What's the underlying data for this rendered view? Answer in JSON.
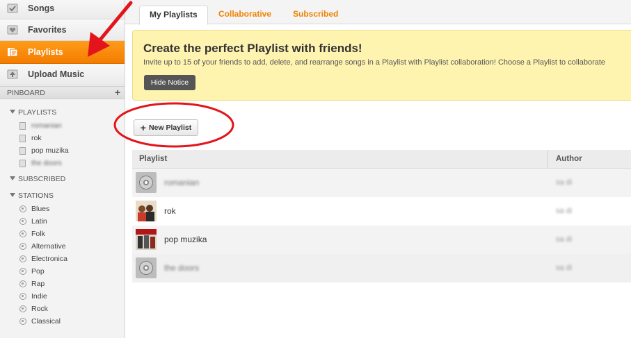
{
  "sidebar": {
    "nav": [
      {
        "label": "Songs",
        "icon": "checkbox-icon"
      },
      {
        "label": "Favorites",
        "icon": "heart-icon"
      },
      {
        "label": "Playlists",
        "icon": "playlist-icon",
        "active": true
      },
      {
        "label": "Upload Music",
        "icon": "upload-icon"
      }
    ],
    "pinboard": {
      "label": "PINBOARD",
      "add": "+"
    },
    "playlists_header": "PLAYLISTS",
    "playlists": [
      "romanian",
      "rok",
      "pop muzika",
      "the doors"
    ],
    "subscribed_header": "SUBSCRIBED",
    "stations_header": "STATIONS",
    "stations": [
      "Blues",
      "Latin",
      "Folk",
      "Alternative",
      "Electronica",
      "Pop",
      "Rap",
      "Indie",
      "Rock",
      "Classical"
    ]
  },
  "tabs": [
    "My Playlists",
    "Collaborative",
    "Subscribed"
  ],
  "notice": {
    "title": "Create the perfect Playlist with friends!",
    "body": "Invite up to 15 of your friends to add, delete, and rearrange songs in a Playlist with Playlist collaboration! Choose a Playlist to collaborate",
    "hide_label": "Hide Notice"
  },
  "new_playlist_label": "New Playlist",
  "table": {
    "headers": {
      "playlist": "Playlist",
      "author": "Author"
    },
    "rows": [
      {
        "name": "romanian",
        "author": "sa di",
        "thumb": "disc-icon"
      },
      {
        "name": "rok",
        "author": "sa di",
        "thumb": "album-cover"
      },
      {
        "name": "pop muzika",
        "author": "sa di",
        "thumb": "album-cover"
      },
      {
        "name": "the doors",
        "author": "sa di",
        "thumb": "disc-icon"
      }
    ]
  },
  "colors": {
    "accent": "#f47d00",
    "notice_bg": "#fff3b0",
    "annotation": "#e3151a"
  }
}
